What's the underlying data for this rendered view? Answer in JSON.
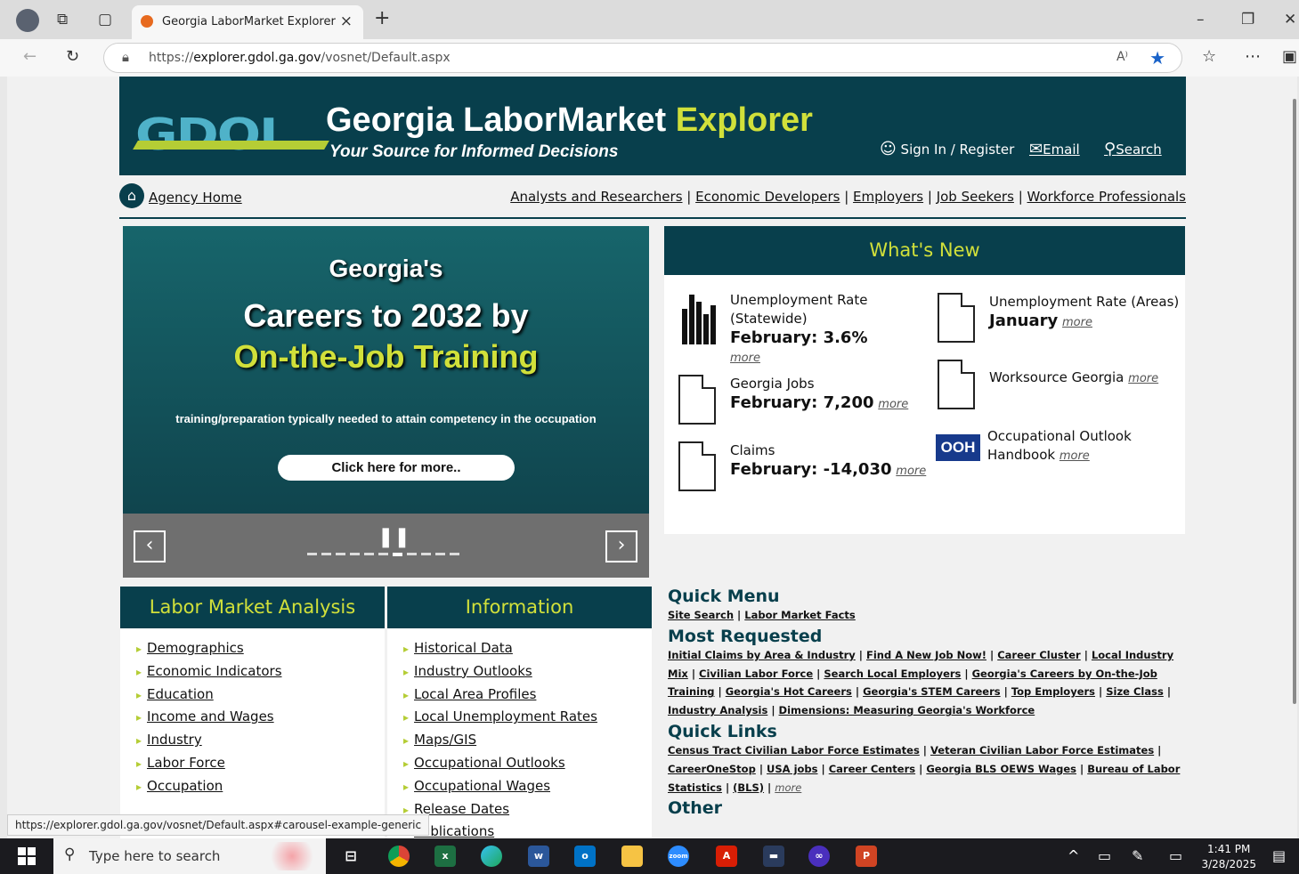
{
  "browser": {
    "tab_title": "Georgia LaborMarket Explorer",
    "url_prefix": "https://",
    "url_host": "explorer.gdol.ga.gov",
    "url_path": "/vosnet/Default.aspx",
    "status_url": "https://explorer.gdol.ga.gov/vosnet/Default.aspx#carousel-example-generic"
  },
  "header": {
    "title_main": "Georgia LaborMarket",
    "title_accent": "Explorer",
    "subtitle": "Your Source for Informed Decisions",
    "sign_in": "Sign In / Register",
    "email": "Email",
    "search": "Search",
    "accent_color": "#d1e03a",
    "bg_color": "#083f4c"
  },
  "nav": {
    "agency_home": "Agency Home",
    "audiences": [
      "Analysts and Researchers",
      "Economic Developers",
      "Employers",
      "Job Seekers",
      "Workforce Professionals"
    ]
  },
  "carousel": {
    "line1": "Georgia's",
    "line2": "Careers to 2032 by",
    "line3": "On-the-Job Training",
    "line4": "training/preparation typically needed to attain competency in the occupation",
    "button": "Click here for more..",
    "prev": "‹",
    "next": "›",
    "pause": "❚❚",
    "slide_count": 11,
    "active_slide": 6
  },
  "whats_new": {
    "heading": "What's New",
    "items": [
      {
        "label": "Unemployment Rate (Statewide)",
        "value": "February: 3.6%",
        "more": "more",
        "icon": "bar-chart-icon"
      },
      {
        "label": "Georgia Jobs",
        "value": "February: 7,200",
        "more": "more",
        "icon": "document-icon"
      },
      {
        "label": "Claims",
        "value": "February: -14,030",
        "more": "more",
        "icon": "document-icon"
      },
      {
        "label": "Unemployment Rate (Areas)",
        "value": "January",
        "more": "more",
        "icon": "document-icon"
      },
      {
        "label": "Worksource Georgia",
        "value": "",
        "more": "more",
        "icon": "document-icon"
      },
      {
        "label": "Occupational Outlook Handbook",
        "value": "",
        "more": "more",
        "icon": "ooh-logo",
        "badge": "OOH"
      }
    ]
  },
  "lma": {
    "heading": "Labor Market Analysis",
    "items": [
      "Demographics",
      "Economic Indicators",
      "Education",
      "Income and Wages",
      "Industry",
      "Labor Force",
      "Occupation"
    ]
  },
  "info": {
    "heading": "Information",
    "items": [
      "Historical Data",
      "Industry Outlooks",
      "Local Area Profiles",
      "Local Unemployment Rates",
      "Maps/GIS",
      "Occupational Outlooks",
      "Occupational Wages",
      "Release Dates",
      "Publications"
    ]
  },
  "quick_menu": {
    "heading": "Quick Menu",
    "links": [
      "Site Search",
      "Labor Market Facts"
    ]
  },
  "most_requested": {
    "heading": "Most Requested",
    "links": [
      "Initial Claims by Area & Industry",
      "Find A New Job Now!",
      "Career Cluster",
      "Local Industry Mix",
      "Civilian Labor Force",
      "Search Local Employers",
      "Georgia's Careers by On-the-Job Training",
      "Georgia's Hot Careers",
      "Georgia's STEM Careers",
      "Top Employers",
      "Size Class",
      "Industry Analysis",
      "Dimensions: Measuring Georgia's Workforce"
    ]
  },
  "quick_links": {
    "heading": "Quick Links",
    "links": [
      "Census Tract Civilian Labor Force Estimates",
      "Veteran Civilian Labor Force Estimates",
      "CareerOneStop",
      "USA jobs",
      "Career Centers",
      "Georgia BLS OEWS Wages",
      "Bureau of Labor Statistics",
      "(BLS)"
    ],
    "more": "more"
  },
  "other": {
    "heading": "Other"
  },
  "taskbar": {
    "search_placeholder": "Type here to search",
    "time": "1:41 PM",
    "date": "3/28/2025"
  }
}
